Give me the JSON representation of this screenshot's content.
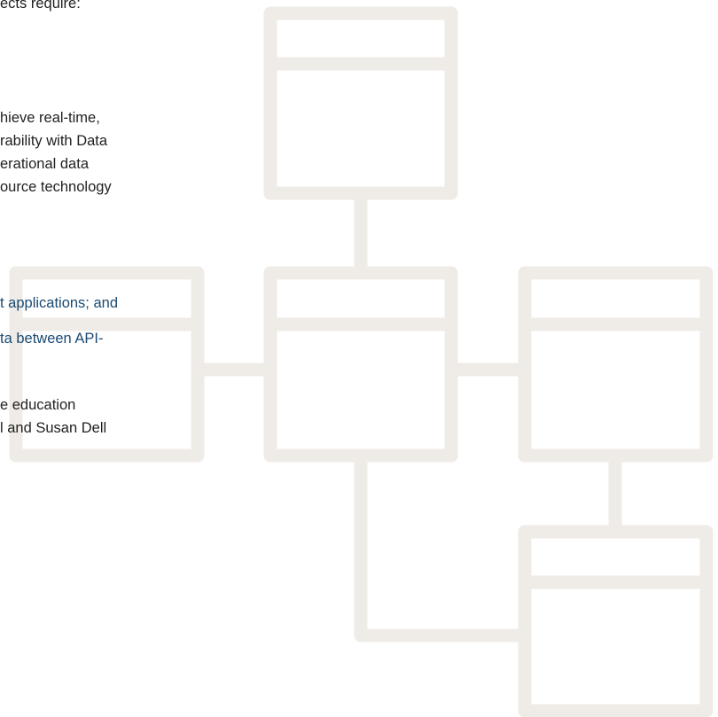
{
  "colors": {
    "diagram_stroke": "#efece8",
    "text_dark": "#1f1f1f",
    "text_link": "#1a4a73"
  },
  "text_lines": [
    "ects require:",
    "hieve real-time,",
    "rability with Data",
    "erational data",
    "ource technology",
    "t applications; and",
    "ta between API-",
    "e education",
    "l and Susan Dell"
  ]
}
